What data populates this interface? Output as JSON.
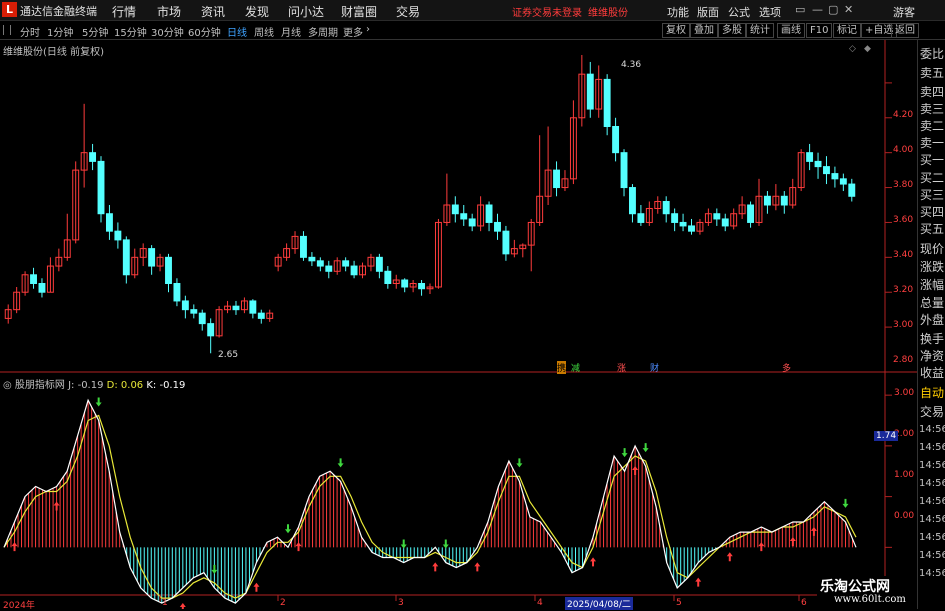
{
  "window": {
    "app_title": "通达信金融终端",
    "logo": "L",
    "menu": [
      "行情",
      "市场",
      "资讯",
      "发现",
      "问小达",
      "财富圈",
      "交易"
    ],
    "login_status": "证券交易未登录",
    "stock_title": "维维股份",
    "right_menu": [
      "功能",
      "版面",
      "公式",
      "选项"
    ],
    "user": "游客"
  },
  "period_bar": {
    "periods": [
      "分时",
      "1分钟",
      "5分钟",
      "15分钟",
      "30分钟",
      "60分钟",
      "日线",
      "周线",
      "月线",
      "多周期",
      "更多"
    ],
    "active": "日线",
    "tools": [
      "复权",
      "叠加",
      "多股",
      "统计",
      "画线",
      "F10",
      "标记",
      "+自选",
      "返回"
    ]
  },
  "price_panel": {
    "label": "维维股份(日线 前复权)",
    "y_ticks": [
      "4.20",
      "4.00",
      "3.80",
      "3.60",
      "3.40",
      "3.20",
      "3.00",
      "2.80"
    ],
    "high_label": "4.36",
    "low_label": "2.65",
    "events": [
      "携",
      "减",
      "涨",
      "财",
      "多"
    ]
  },
  "indicator_panel": {
    "name": "股朋指标网",
    "j": "J: -0.19",
    "d": "D: 0.06",
    "k": "K: -0.19",
    "y_ticks": [
      "3.00",
      "2.00",
      "1.00",
      "0.00"
    ],
    "current_value": "1.74"
  },
  "x_axis": {
    "labels": [
      "2024年",
      "1",
      "2",
      "3",
      "4",
      "5",
      "6"
    ],
    "cursor_date": "2025/04/08/二"
  },
  "sidebar": {
    "items": [
      "委比",
      "卖五",
      "卖四",
      "卖三",
      "卖二",
      "卖一",
      "买一",
      "买二",
      "买三",
      "买四",
      "买五",
      "现价",
      "涨跌",
      "涨幅",
      "总量",
      "外盘",
      "换手",
      "净资",
      "收益"
    ],
    "mode": "自动",
    "trade": "交易",
    "times": [
      "14:56",
      "14:56",
      "14:56",
      "14:56",
      "14:56",
      "14:56",
      "14:56",
      "14:56",
      "14:56"
    ]
  },
  "watermark": {
    "title": "乐淘公式网",
    "url": "www.60lt.com"
  },
  "colors": {
    "up": "#ff3c3c",
    "down": "#54ffff",
    "k_line": "#ffffff",
    "d_line": "#e8e838",
    "axis": "#b22222",
    "active": "#3fa3ff"
  },
  "chart_data": [
    {
      "type": "candlestick",
      "title": "维维股份(日线 前复权)",
      "ylim": [
        2.6,
        4.4
      ],
      "candles": [
        [
          2.85,
          2.9,
          2.82,
          2.93
        ],
        [
          2.9,
          3.0,
          2.88,
          3.03
        ],
        [
          3.0,
          3.1,
          2.98,
          3.12
        ],
        [
          3.1,
          3.05,
          3.02,
          3.14
        ],
        [
          3.05,
          3.0,
          2.97,
          3.08
        ],
        [
          3.0,
          3.15,
          3.0,
          3.2
        ],
        [
          3.15,
          3.2,
          3.12,
          3.25
        ],
        [
          3.2,
          3.3,
          3.18,
          3.45
        ],
        [
          3.3,
          3.7,
          3.28,
          3.75
        ],
        [
          3.7,
          3.8,
          3.6,
          4.08
        ],
        [
          3.8,
          3.75,
          3.7,
          3.85
        ],
        [
          3.75,
          3.45,
          3.4,
          3.78
        ],
        [
          3.45,
          3.35,
          3.3,
          3.5
        ],
        [
          3.35,
          3.3,
          3.25,
          3.4
        ],
        [
          3.3,
          3.1,
          3.05,
          3.32
        ],
        [
          3.1,
          3.2,
          3.08,
          3.25
        ],
        [
          3.2,
          3.25,
          3.15,
          3.28
        ],
        [
          3.25,
          3.15,
          3.1,
          3.27
        ],
        [
          3.15,
          3.2,
          3.12,
          3.22
        ],
        [
          3.2,
          3.05,
          3.0,
          3.22
        ],
        [
          3.05,
          2.95,
          2.92,
          3.08
        ],
        [
          2.95,
          2.9,
          2.85,
          2.98
        ],
        [
          2.9,
          2.88,
          2.85,
          2.93
        ],
        [
          2.88,
          2.82,
          2.78,
          2.9
        ],
        [
          2.82,
          2.75,
          2.65,
          2.85
        ],
        [
          2.75,
          2.9,
          2.74,
          2.92
        ],
        [
          2.9,
          2.92,
          2.88,
          2.95
        ],
        [
          2.92,
          2.9,
          2.87,
          2.95
        ],
        [
          2.9,
          2.95,
          2.88,
          2.97
        ],
        [
          2.95,
          2.88,
          2.85,
          2.96
        ],
        [
          2.88,
          2.85,
          2.82,
          2.9
        ],
        [
          2.85,
          2.88,
          2.83,
          2.9
        ],
        [
          3.15,
          3.2,
          3.12,
          3.22
        ],
        [
          3.2,
          3.25,
          3.18,
          3.28
        ],
        [
          3.25,
          3.32,
          3.22,
          3.35
        ],
        [
          3.32,
          3.2,
          3.18,
          3.35
        ],
        [
          3.2,
          3.18,
          3.15,
          3.23
        ],
        [
          3.18,
          3.15,
          3.12,
          3.2
        ],
        [
          3.15,
          3.12,
          3.08,
          3.18
        ],
        [
          3.12,
          3.18,
          3.1,
          3.2
        ],
        [
          3.18,
          3.15,
          3.12,
          3.2
        ],
        [
          3.15,
          3.1,
          3.08,
          3.18
        ],
        [
          3.1,
          3.15,
          3.08,
          3.17
        ],
        [
          3.15,
          3.2,
          3.12,
          3.22
        ],
        [
          3.2,
          3.12,
          3.08,
          3.22
        ],
        [
          3.12,
          3.05,
          3.02,
          3.15
        ],
        [
          3.05,
          3.07,
          3.02,
          3.1
        ],
        [
          3.07,
          3.03,
          3.0,
          3.08
        ],
        [
          3.03,
          3.05,
          3.0,
          3.07
        ],
        [
          3.05,
          3.02,
          2.98,
          3.07
        ],
        [
          3.02,
          3.03,
          2.99,
          3.05
        ],
        [
          3.03,
          3.4,
          3.02,
          3.42
        ],
        [
          3.4,
          3.5,
          3.38,
          3.68
        ],
        [
          3.5,
          3.45,
          3.4,
          3.55
        ],
        [
          3.45,
          3.42,
          3.38,
          3.5
        ],
        [
          3.42,
          3.38,
          3.35,
          3.45
        ],
        [
          3.38,
          3.5,
          3.35,
          3.55
        ],
        [
          3.5,
          3.4,
          3.35,
          3.52
        ],
        [
          3.4,
          3.35,
          3.3,
          3.45
        ],
        [
          3.35,
          3.22,
          3.18,
          3.38
        ],
        [
          3.22,
          3.25,
          3.2,
          3.3
        ],
        [
          3.25,
          3.27,
          3.2,
          3.28
        ],
        [
          3.27,
          3.4,
          3.12,
          3.42
        ],
        [
          3.4,
          3.55,
          3.38,
          3.9
        ],
        [
          3.55,
          3.7,
          3.5,
          3.95
        ],
        [
          3.7,
          3.6,
          3.55,
          3.75
        ],
        [
          3.6,
          3.65,
          3.58,
          3.7
        ],
        [
          3.65,
          4.0,
          3.62,
          4.1
        ],
        [
          4.0,
          4.25,
          3.95,
          4.36
        ],
        [
          4.25,
          4.05,
          4.0,
          4.32
        ],
        [
          4.05,
          4.22,
          4.0,
          4.3
        ],
        [
          4.22,
          3.95,
          3.9,
          4.25
        ],
        [
          3.95,
          3.8,
          3.75,
          4.0
        ],
        [
          3.8,
          3.6,
          3.55,
          3.82
        ],
        [
          3.6,
          3.45,
          3.4,
          3.62
        ],
        [
          3.45,
          3.4,
          3.38,
          3.5
        ],
        [
          3.4,
          3.48,
          3.38,
          3.52
        ],
        [
          3.48,
          3.52,
          3.45,
          3.55
        ],
        [
          3.52,
          3.45,
          3.4,
          3.55
        ],
        [
          3.45,
          3.4,
          3.35,
          3.48
        ],
        [
          3.4,
          3.38,
          3.35,
          3.45
        ],
        [
          3.38,
          3.35,
          3.33,
          3.42
        ],
        [
          3.35,
          3.4,
          3.33,
          3.42
        ],
        [
          3.4,
          3.45,
          3.38,
          3.48
        ],
        [
          3.45,
          3.42,
          3.38,
          3.48
        ],
        [
          3.42,
          3.38,
          3.35,
          3.45
        ],
        [
          3.38,
          3.45,
          3.36,
          3.48
        ],
        [
          3.45,
          3.5,
          3.42,
          3.55
        ],
        [
          3.5,
          3.4,
          3.37,
          3.52
        ],
        [
          3.4,
          3.55,
          3.38,
          3.65
        ],
        [
          3.55,
          3.5,
          3.45,
          3.58
        ],
        [
          3.5,
          3.55,
          3.47,
          3.62
        ],
        [
          3.55,
          3.5,
          3.45,
          3.58
        ],
        [
          3.5,
          3.6,
          3.48,
          3.65
        ],
        [
          3.6,
          3.8,
          3.58,
          3.82
        ],
        [
          3.8,
          3.75,
          3.7,
          3.85
        ],
        [
          3.75,
          3.72,
          3.65,
          3.8
        ],
        [
          3.72,
          3.68,
          3.62,
          3.78
        ],
        [
          3.68,
          3.65,
          3.6,
          3.72
        ],
        [
          3.65,
          3.62,
          3.58,
          3.68
        ],
        [
          3.62,
          3.55,
          3.52,
          3.65
        ]
      ]
    },
    {
      "type": "line",
      "title": "股朋指标网",
      "ylim": [
        -0.9,
        3.2
      ],
      "series": [
        {
          "name": "K",
          "values": [
            0.0,
            0.5,
            1.0,
            1.2,
            1.1,
            1.2,
            1.5,
            2.2,
            2.9,
            2.5,
            1.5,
            0.3,
            -0.4,
            -0.8,
            -1.0,
            -1.1,
            -1.0,
            -0.8,
            -0.6,
            -0.5,
            -0.8,
            -1.0,
            -1.1,
            -0.9,
            -0.3,
            0.1,
            0.2,
            0.0,
            0.4,
            1.0,
            1.4,
            1.5,
            1.3,
            0.8,
            0.2,
            -0.1,
            -0.2,
            -0.2,
            -0.3,
            -0.2,
            -0.2,
            0.0,
            -0.3,
            -0.4,
            -0.3,
            0.0,
            0.5,
            1.2,
            1.7,
            1.3,
            0.6,
            0.5,
            0.2,
            -0.1,
            -0.5,
            -0.4,
            0.2,
            1.0,
            1.8,
            1.5,
            2.0,
            1.6,
            0.8,
            -0.3,
            -0.8,
            -0.6,
            -0.3,
            -0.1,
            0.0,
            0.2,
            0.3,
            0.3,
            0.4,
            0.3,
            0.4,
            0.5,
            0.5,
            0.7,
            0.9,
            0.7,
            0.5,
            0.0
          ]
        },
        {
          "name": "D",
          "values": [
            0.0,
            0.3,
            0.7,
            1.0,
            1.1,
            1.1,
            1.3,
            1.8,
            2.5,
            2.6,
            2.0,
            1.0,
            0.2,
            -0.4,
            -0.8,
            -1.0,
            -1.0,
            -0.9,
            -0.7,
            -0.6,
            -0.7,
            -0.9,
            -1.0,
            -0.9,
            -0.5,
            -0.1,
            0.1,
            0.1,
            0.3,
            0.8,
            1.2,
            1.4,
            1.4,
            1.0,
            0.5,
            0.1,
            -0.1,
            -0.2,
            -0.2,
            -0.2,
            -0.2,
            -0.1,
            -0.2,
            -0.3,
            -0.3,
            -0.1,
            0.3,
            0.9,
            1.4,
            1.4,
            0.9,
            0.6,
            0.3,
            0.0,
            -0.3,
            -0.4,
            0.0,
            0.7,
            1.4,
            1.6,
            1.8,
            1.7,
            1.1,
            0.2,
            -0.5,
            -0.6,
            -0.4,
            -0.2,
            0.0,
            0.1,
            0.2,
            0.3,
            0.3,
            0.3,
            0.4,
            0.4,
            0.5,
            0.6,
            0.8,
            0.7,
            0.6,
            0.2
          ]
        }
      ]
    }
  ]
}
